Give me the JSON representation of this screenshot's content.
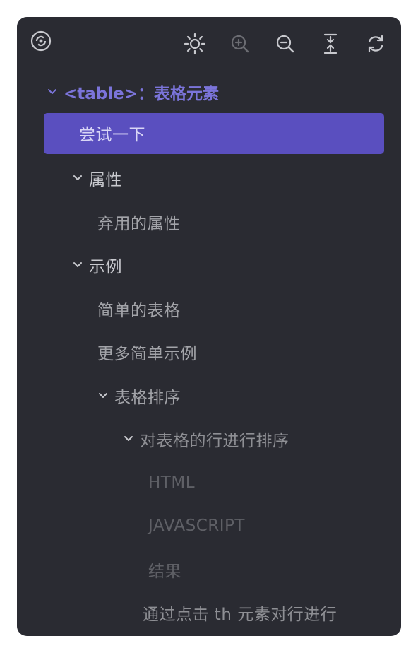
{
  "toolbar": {
    "icons": [
      "outline-logo-icon",
      "brightness-icon",
      "zoom-in-icon",
      "zoom-out-icon",
      "collapse-all-icon",
      "refresh-icon"
    ]
  },
  "colors": {
    "panel_bg": "#2a2b32",
    "accent": "#7b74da",
    "highlight_bg": "#5a4fbf"
  },
  "outline": {
    "root": "<table>：表格元素",
    "items": [
      {
        "label": "尝试一下",
        "expanded": null,
        "active": true
      },
      {
        "label": "属性",
        "expanded": true
      },
      {
        "label": "弃用的属性"
      },
      {
        "label": "示例",
        "expanded": true
      },
      {
        "label": "简单的表格"
      },
      {
        "label": "更多简单示例"
      },
      {
        "label": "表格排序",
        "expanded": true
      },
      {
        "label": "对表格的行进行排序",
        "expanded": true
      },
      {
        "label": "HTML"
      },
      {
        "label": "JAVASCRIPT"
      },
      {
        "label": "结果"
      },
      {
        "label": "通过点击 th 元素对行进行"
      }
    ]
  }
}
